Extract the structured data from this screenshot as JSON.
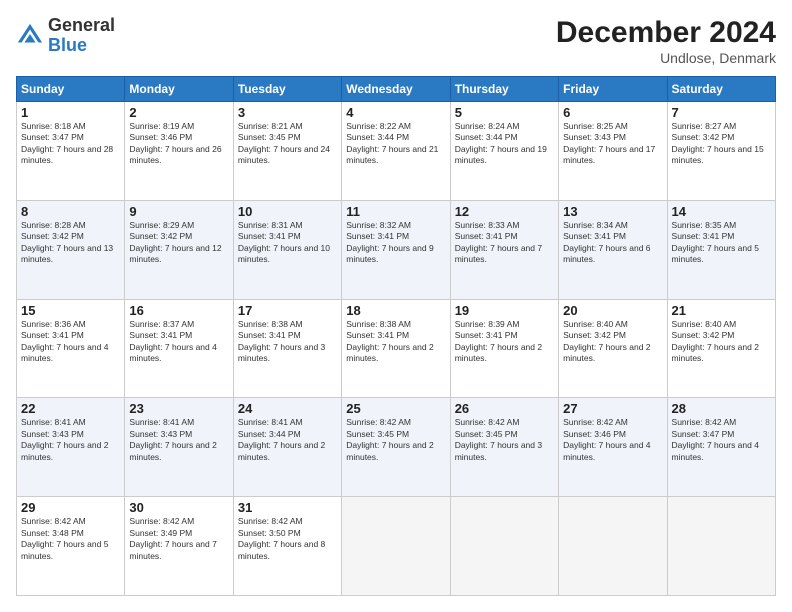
{
  "header": {
    "logo": {
      "general": "General",
      "blue": "Blue"
    },
    "title": "December 2024",
    "location": "Undlose, Denmark"
  },
  "days_of_week": [
    "Sunday",
    "Monday",
    "Tuesday",
    "Wednesday",
    "Thursday",
    "Friday",
    "Saturday"
  ],
  "weeks": [
    [
      {
        "day": "1",
        "sunrise": "8:18 AM",
        "sunset": "3:47 PM",
        "daylight": "7 hours and 28 minutes."
      },
      {
        "day": "2",
        "sunrise": "8:19 AM",
        "sunset": "3:46 PM",
        "daylight": "7 hours and 26 minutes."
      },
      {
        "day": "3",
        "sunrise": "8:21 AM",
        "sunset": "3:45 PM",
        "daylight": "7 hours and 24 minutes."
      },
      {
        "day": "4",
        "sunrise": "8:22 AM",
        "sunset": "3:44 PM",
        "daylight": "7 hours and 21 minutes."
      },
      {
        "day": "5",
        "sunrise": "8:24 AM",
        "sunset": "3:44 PM",
        "daylight": "7 hours and 19 minutes."
      },
      {
        "day": "6",
        "sunrise": "8:25 AM",
        "sunset": "3:43 PM",
        "daylight": "7 hours and 17 minutes."
      },
      {
        "day": "7",
        "sunrise": "8:27 AM",
        "sunset": "3:42 PM",
        "daylight": "7 hours and 15 minutes."
      }
    ],
    [
      {
        "day": "8",
        "sunrise": "8:28 AM",
        "sunset": "3:42 PM",
        "daylight": "7 hours and 13 minutes."
      },
      {
        "day": "9",
        "sunrise": "8:29 AM",
        "sunset": "3:42 PM",
        "daylight": "7 hours and 12 minutes."
      },
      {
        "day": "10",
        "sunrise": "8:31 AM",
        "sunset": "3:41 PM",
        "daylight": "7 hours and 10 minutes."
      },
      {
        "day": "11",
        "sunrise": "8:32 AM",
        "sunset": "3:41 PM",
        "daylight": "7 hours and 9 minutes."
      },
      {
        "day": "12",
        "sunrise": "8:33 AM",
        "sunset": "3:41 PM",
        "daylight": "7 hours and 7 minutes."
      },
      {
        "day": "13",
        "sunrise": "8:34 AM",
        "sunset": "3:41 PM",
        "daylight": "7 hours and 6 minutes."
      },
      {
        "day": "14",
        "sunrise": "8:35 AM",
        "sunset": "3:41 PM",
        "daylight": "7 hours and 5 minutes."
      }
    ],
    [
      {
        "day": "15",
        "sunrise": "8:36 AM",
        "sunset": "3:41 PM",
        "daylight": "7 hours and 4 minutes."
      },
      {
        "day": "16",
        "sunrise": "8:37 AM",
        "sunset": "3:41 PM",
        "daylight": "7 hours and 4 minutes."
      },
      {
        "day": "17",
        "sunrise": "8:38 AM",
        "sunset": "3:41 PM",
        "daylight": "7 hours and 3 minutes."
      },
      {
        "day": "18",
        "sunrise": "8:38 AM",
        "sunset": "3:41 PM",
        "daylight": "7 hours and 2 minutes."
      },
      {
        "day": "19",
        "sunrise": "8:39 AM",
        "sunset": "3:41 PM",
        "daylight": "7 hours and 2 minutes."
      },
      {
        "day": "20",
        "sunrise": "8:40 AM",
        "sunset": "3:42 PM",
        "daylight": "7 hours and 2 minutes."
      },
      {
        "day": "21",
        "sunrise": "8:40 AM",
        "sunset": "3:42 PM",
        "daylight": "7 hours and 2 minutes."
      }
    ],
    [
      {
        "day": "22",
        "sunrise": "8:41 AM",
        "sunset": "3:43 PM",
        "daylight": "7 hours and 2 minutes."
      },
      {
        "day": "23",
        "sunrise": "8:41 AM",
        "sunset": "3:43 PM",
        "daylight": "7 hours and 2 minutes."
      },
      {
        "day": "24",
        "sunrise": "8:41 AM",
        "sunset": "3:44 PM",
        "daylight": "7 hours and 2 minutes."
      },
      {
        "day": "25",
        "sunrise": "8:42 AM",
        "sunset": "3:45 PM",
        "daylight": "7 hours and 2 minutes."
      },
      {
        "day": "26",
        "sunrise": "8:42 AM",
        "sunset": "3:45 PM",
        "daylight": "7 hours and 3 minutes."
      },
      {
        "day": "27",
        "sunrise": "8:42 AM",
        "sunset": "3:46 PM",
        "daylight": "7 hours and 4 minutes."
      },
      {
        "day": "28",
        "sunrise": "8:42 AM",
        "sunset": "3:47 PM",
        "daylight": "7 hours and 4 minutes."
      }
    ],
    [
      {
        "day": "29",
        "sunrise": "8:42 AM",
        "sunset": "3:48 PM",
        "daylight": "7 hours and 5 minutes."
      },
      {
        "day": "30",
        "sunrise": "8:42 AM",
        "sunset": "3:49 PM",
        "daylight": "7 hours and 7 minutes."
      },
      {
        "day": "31",
        "sunrise": "8:42 AM",
        "sunset": "3:50 PM",
        "daylight": "7 hours and 8 minutes."
      },
      null,
      null,
      null,
      null
    ]
  ]
}
